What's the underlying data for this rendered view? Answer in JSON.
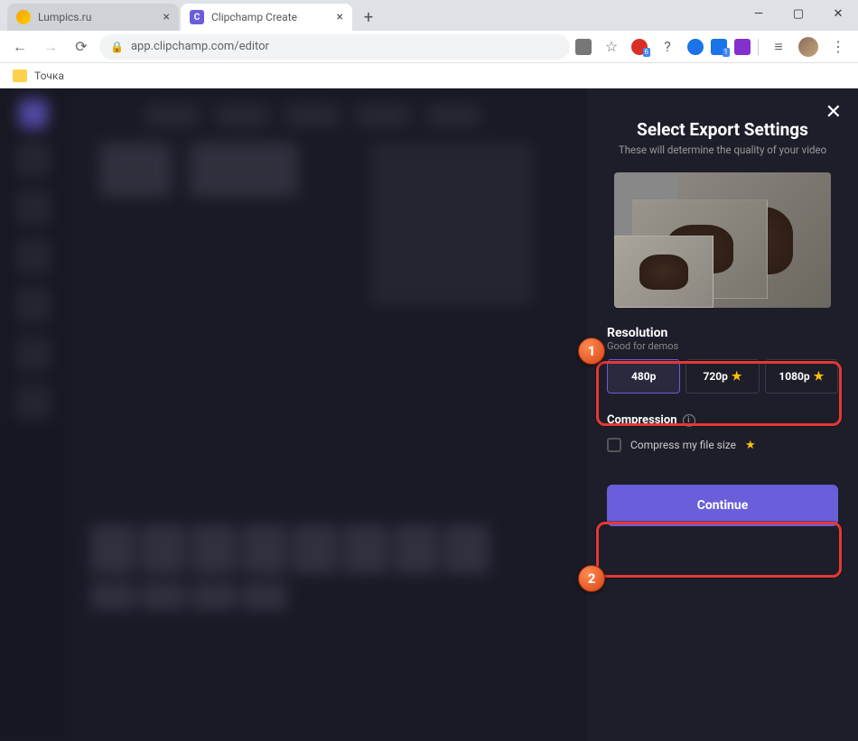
{
  "tabs": [
    {
      "title": "Lumpics.ru"
    },
    {
      "title": "Clipchamp Create"
    }
  ],
  "fav_c_letter": "C",
  "url": "app.clipchamp.com/editor",
  "bookmark": "Точка",
  "panel": {
    "title": "Select Export Settings",
    "subtitle": "These will determine the quality of your video",
    "resolution_label": "Resolution",
    "resolution_hint": "Good for demos",
    "res": [
      "480p",
      "720p",
      "1080p"
    ],
    "compression_label": "Compression",
    "compress_text": "Compress my file size",
    "continue": "Continue"
  },
  "markers": {
    "m1": "1",
    "m2": "2"
  }
}
